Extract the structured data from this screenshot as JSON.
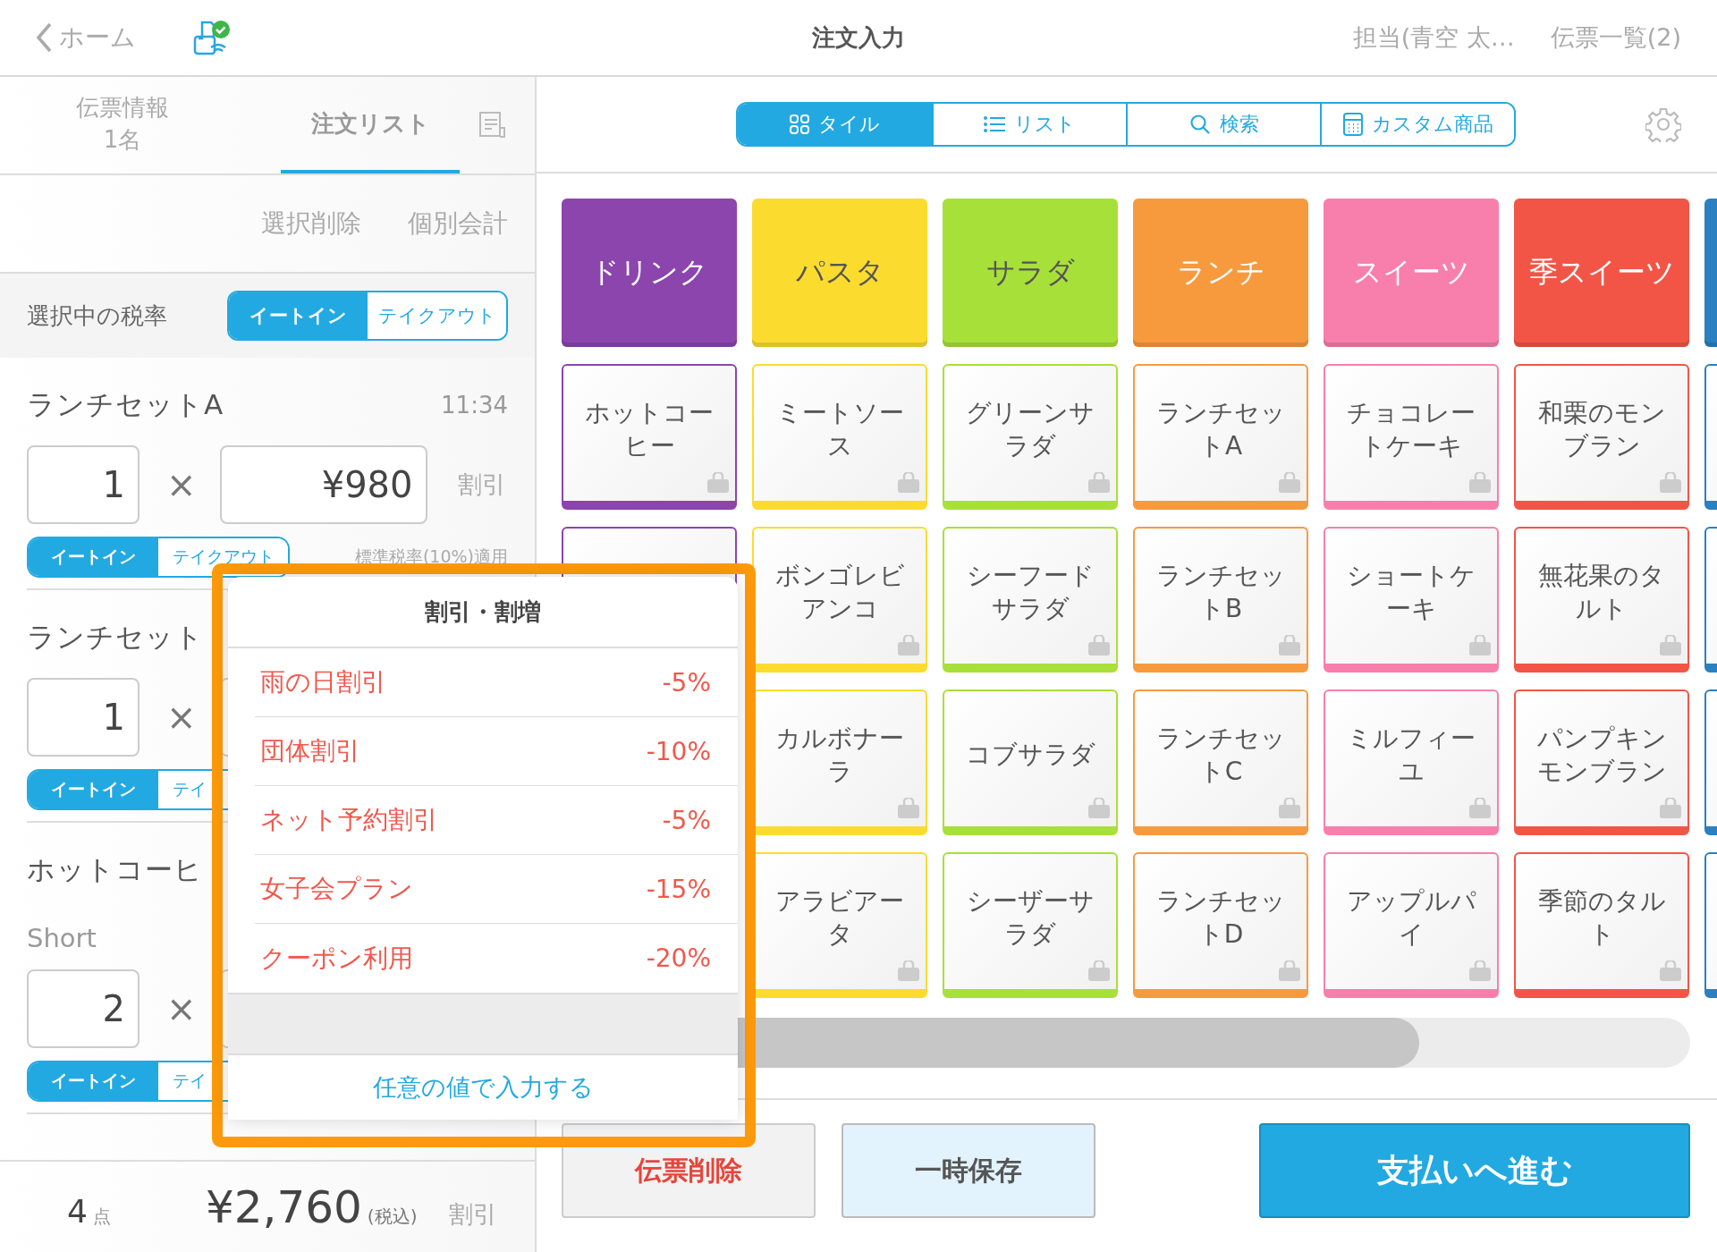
{
  "top_bar": {
    "back": "ホーム",
    "title": "注文入力",
    "staff": "担当(青空 太…",
    "slips": "伝票一覧(2)"
  },
  "left_tabs": [
    {
      "label": "伝票情報",
      "sub": "1名",
      "selected": false
    },
    {
      "label": "注文リスト",
      "selected": true
    }
  ],
  "actions": [
    "選択削除",
    "個別会計"
  ],
  "tax_selector": {
    "label": "選択中の税率",
    "options": [
      {
        "label": "イートイン",
        "selected": true
      },
      {
        "label": "テイクアウト",
        "selected": false
      }
    ]
  },
  "order_items": [
    {
      "name": "ランチセットA",
      "time": "11:34",
      "qty": "1",
      "times": "×",
      "price": "¥980",
      "discount": "割引",
      "options": [
        {
          "label": "イートイン",
          "selected": true
        },
        {
          "label": "テイクアウト",
          "selected": false
        }
      ],
      "tax_note": "標準税率(10%)適用"
    },
    {
      "name": "ランチセット",
      "qty": "1",
      "times": "×",
      "options": [
        {
          "label": "イートイン",
          "selected": true
        },
        {
          "label": "テイ",
          "selected": false
        }
      ]
    },
    {
      "name": "ホットコーヒ",
      "variant": "Short",
      "qty": "2",
      "times": "×",
      "options": [
        {
          "label": "イートイン",
          "selected": true
        },
        {
          "label": "テイ",
          "selected": false
        }
      ]
    }
  ],
  "footer": {
    "count": "4",
    "count_unit": "点",
    "total": "¥2,760",
    "tax_incl": "(税込)",
    "discount": "割引"
  },
  "view_modes": [
    {
      "label": "タイル",
      "selected": true
    },
    {
      "label": "リスト",
      "selected": false
    },
    {
      "label": "検索",
      "selected": false
    },
    {
      "label": "カスタム商品",
      "selected": false
    }
  ],
  "categories": [
    {
      "name": "ドリンク",
      "color": "#8b45ad",
      "dark_text": false,
      "products": [
        {
          "kind": "item",
          "name": "ホットコーヒー"
        },
        {
          "kind": "blank"
        }
      ]
    },
    {
      "name": "パスタ",
      "color": "#fbdc2e",
      "dark_text": true,
      "products": [
        {
          "kind": "item",
          "name": "ミートソース"
        },
        {
          "kind": "item",
          "name": "ボンゴレビアンコ"
        },
        {
          "kind": "item",
          "name": "カルボナーラ"
        },
        {
          "kind": "item",
          "name": "アラビアータ"
        }
      ]
    },
    {
      "name": "サラダ",
      "color": "#a8e03a",
      "dark_text": true,
      "products": [
        {
          "kind": "item",
          "name": "グリーンサラダ"
        },
        {
          "kind": "item",
          "name": "シーフードサラダ"
        },
        {
          "kind": "item",
          "name": "コブサラダ"
        },
        {
          "kind": "item",
          "name": "シーザーサラダ"
        }
      ]
    },
    {
      "name": "ランチ",
      "color": "#f79a3e",
      "dark_text": false,
      "products": [
        {
          "kind": "item",
          "name": "ランチセットA"
        },
        {
          "kind": "item",
          "name": "ランチセットB"
        },
        {
          "kind": "item",
          "name": "ランチセットC"
        },
        {
          "kind": "item",
          "name": "ランチセットD"
        }
      ]
    },
    {
      "name": "スイーツ",
      "color": "#f87fab",
      "dark_text": false,
      "products": [
        {
          "kind": "item",
          "name": "チョコレートケーキ"
        },
        {
          "kind": "item",
          "name": "ショートケーキ"
        },
        {
          "kind": "item",
          "name": "ミルフィーユ"
        },
        {
          "kind": "item",
          "name": "アップルパイ"
        }
      ]
    },
    {
      "name": "季スイーツ",
      "color": "#f25546",
      "dark_text": false,
      "products": [
        {
          "kind": "item",
          "name": "和栗のモンブラン"
        },
        {
          "kind": "item",
          "name": "無花果のタルト"
        },
        {
          "kind": "item",
          "name": "パンプキンモンブラン"
        },
        {
          "kind": "item",
          "name": "季節のタルト"
        }
      ]
    },
    {
      "color": "#2a80c0",
      "products": [
        {
          "kind": "blank"
        },
        {
          "kind": "blank"
        },
        {
          "kind": "blank"
        },
        {
          "kind": "blank"
        }
      ]
    }
  ],
  "popover": {
    "title": "割引・割増",
    "options": [
      {
        "name": "雨の日割引",
        "value": "-5%"
      },
      {
        "name": "団体割引",
        "value": "-10%"
      },
      {
        "name": "ネット予約割引",
        "value": "-5%"
      },
      {
        "name": "女子会プラン",
        "value": "-15%"
      },
      {
        "name": "クーポン利用",
        "value": "-20%"
      }
    ],
    "custom": "任意の値で入力する"
  },
  "bottom_buttons": [
    {
      "label": "伝票削除",
      "kind": "delete"
    },
    {
      "label": "一時保存",
      "kind": "hold"
    },
    {
      "label": "支払いへ進む",
      "kind": "pay"
    }
  ]
}
